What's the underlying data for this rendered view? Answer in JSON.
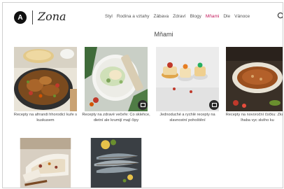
{
  "brand": {
    "logo_letter": "A",
    "name": "Zona"
  },
  "nav": {
    "items": [
      {
        "label": "Styl",
        "active": false
      },
      {
        "label": "Rodina a vztahy",
        "active": false
      },
      {
        "label": "Zábava",
        "active": false
      },
      {
        "label": "Zdraví",
        "active": false
      },
      {
        "label": "Blogy",
        "active": false
      },
      {
        "label": "Mňami",
        "active": true
      },
      {
        "label": "Dle",
        "active": false
      },
      {
        "label": "Vánoce",
        "active": false
      }
    ],
    "accent_color": "#c2185b"
  },
  "section": {
    "title": "Mňami"
  },
  "cards": [
    {
      "caption": "Recepty na afrrandi hhorodicí kuře s kuskusem",
      "has_badge": false
    },
    {
      "caption": "Recepty na zdravé večeře: Co sklehce, dietní ale krumijí mají čipy",
      "has_badge": true
    },
    {
      "caption": "Jednoduché a rychlé recepty na slavnostní pohoštění",
      "has_badge": true
    },
    {
      "caption": "Recepty na novoroční čočku: Zkuste lhaba vyc ského ku",
      "has_badge": false
    },
    {
      "caption": "",
      "has_badge": false
    },
    {
      "caption": "",
      "has_badge": false
    }
  ]
}
